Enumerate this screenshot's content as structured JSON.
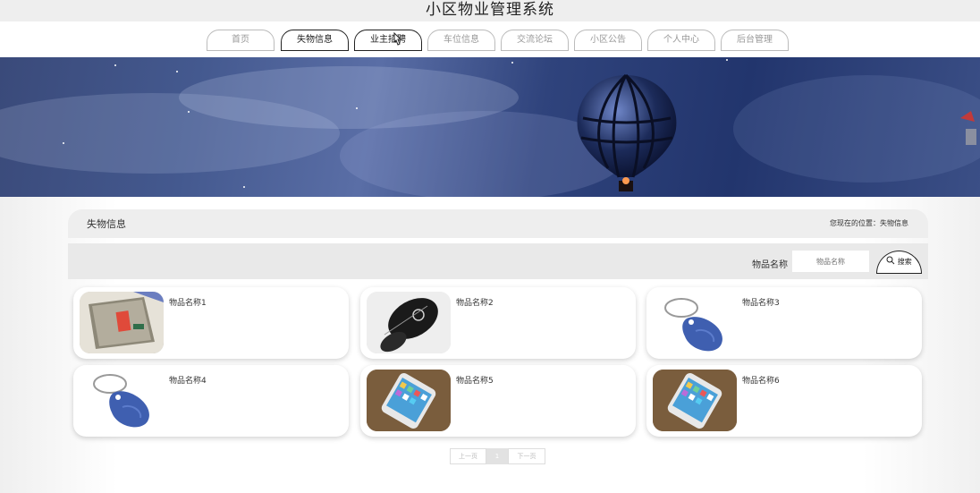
{
  "site": {
    "title": "小区物业管理系统"
  },
  "nav": [
    {
      "label": "首页",
      "active": false
    },
    {
      "label": "失物信息",
      "active": true
    },
    {
      "label": "业主招聘",
      "active": true
    },
    {
      "label": "车位信息",
      "active": false
    },
    {
      "label": "交流论坛",
      "active": false
    },
    {
      "label": "小区公告",
      "active": false
    },
    {
      "label": "个人中心",
      "active": false
    },
    {
      "label": "后台管理",
      "active": false
    }
  ],
  "section": {
    "title": "失物信息",
    "breadcrumb": "您现在的位置：失物信息"
  },
  "search": {
    "label": "物品名称",
    "placeholder": "物品名称",
    "button": "搜索",
    "button_icon": "search-icon"
  },
  "items": [
    {
      "name": "物品名称1",
      "image": "card-reader"
    },
    {
      "name": "物品名称2",
      "image": "car-key"
    },
    {
      "name": "物品名称3",
      "image": "key-fob"
    },
    {
      "name": "物品名称4",
      "image": "key-fob"
    },
    {
      "name": "物品名称5",
      "image": "phone"
    },
    {
      "name": "物品名称6",
      "image": "phone"
    }
  ],
  "pagination": {
    "prev": "上一页",
    "current": "1",
    "next": "下一页"
  }
}
